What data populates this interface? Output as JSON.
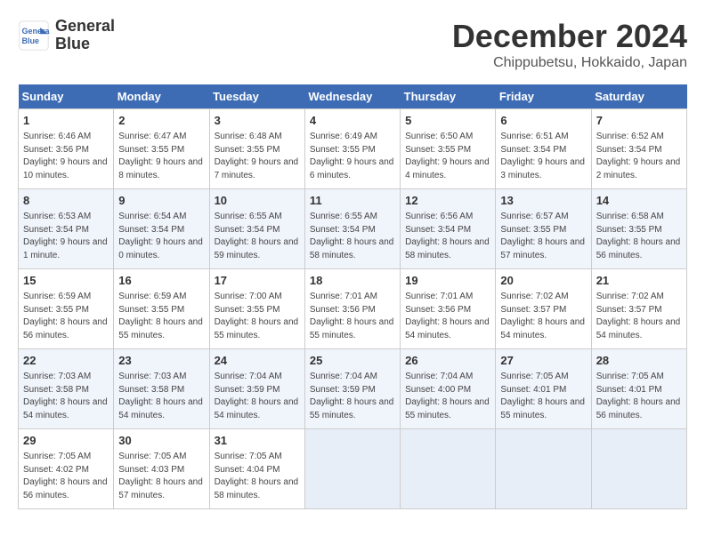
{
  "logo": {
    "line1": "General",
    "line2": "Blue"
  },
  "title": "December 2024",
  "subtitle": "Chippubetsu, Hokkaido, Japan",
  "headers": [
    "Sunday",
    "Monday",
    "Tuesday",
    "Wednesday",
    "Thursday",
    "Friday",
    "Saturday"
  ],
  "weeks": [
    [
      {
        "day": "1",
        "info": "Sunrise: 6:46 AM\nSunset: 3:56 PM\nDaylight: 9 hours and 10 minutes."
      },
      {
        "day": "2",
        "info": "Sunrise: 6:47 AM\nSunset: 3:55 PM\nDaylight: 9 hours and 8 minutes."
      },
      {
        "day": "3",
        "info": "Sunrise: 6:48 AM\nSunset: 3:55 PM\nDaylight: 9 hours and 7 minutes."
      },
      {
        "day": "4",
        "info": "Sunrise: 6:49 AM\nSunset: 3:55 PM\nDaylight: 9 hours and 6 minutes."
      },
      {
        "day": "5",
        "info": "Sunrise: 6:50 AM\nSunset: 3:55 PM\nDaylight: 9 hours and 4 minutes."
      },
      {
        "day": "6",
        "info": "Sunrise: 6:51 AM\nSunset: 3:54 PM\nDaylight: 9 hours and 3 minutes."
      },
      {
        "day": "7",
        "info": "Sunrise: 6:52 AM\nSunset: 3:54 PM\nDaylight: 9 hours and 2 minutes."
      }
    ],
    [
      {
        "day": "8",
        "info": "Sunrise: 6:53 AM\nSunset: 3:54 PM\nDaylight: 9 hours and 1 minute."
      },
      {
        "day": "9",
        "info": "Sunrise: 6:54 AM\nSunset: 3:54 PM\nDaylight: 9 hours and 0 minutes."
      },
      {
        "day": "10",
        "info": "Sunrise: 6:55 AM\nSunset: 3:54 PM\nDaylight: 8 hours and 59 minutes."
      },
      {
        "day": "11",
        "info": "Sunrise: 6:55 AM\nSunset: 3:54 PM\nDaylight: 8 hours and 58 minutes."
      },
      {
        "day": "12",
        "info": "Sunrise: 6:56 AM\nSunset: 3:54 PM\nDaylight: 8 hours and 58 minutes."
      },
      {
        "day": "13",
        "info": "Sunrise: 6:57 AM\nSunset: 3:55 PM\nDaylight: 8 hours and 57 minutes."
      },
      {
        "day": "14",
        "info": "Sunrise: 6:58 AM\nSunset: 3:55 PM\nDaylight: 8 hours and 56 minutes."
      }
    ],
    [
      {
        "day": "15",
        "info": "Sunrise: 6:59 AM\nSunset: 3:55 PM\nDaylight: 8 hours and 56 minutes."
      },
      {
        "day": "16",
        "info": "Sunrise: 6:59 AM\nSunset: 3:55 PM\nDaylight: 8 hours and 55 minutes."
      },
      {
        "day": "17",
        "info": "Sunrise: 7:00 AM\nSunset: 3:55 PM\nDaylight: 8 hours and 55 minutes."
      },
      {
        "day": "18",
        "info": "Sunrise: 7:01 AM\nSunset: 3:56 PM\nDaylight: 8 hours and 55 minutes."
      },
      {
        "day": "19",
        "info": "Sunrise: 7:01 AM\nSunset: 3:56 PM\nDaylight: 8 hours and 54 minutes."
      },
      {
        "day": "20",
        "info": "Sunrise: 7:02 AM\nSunset: 3:57 PM\nDaylight: 8 hours and 54 minutes."
      },
      {
        "day": "21",
        "info": "Sunrise: 7:02 AM\nSunset: 3:57 PM\nDaylight: 8 hours and 54 minutes."
      }
    ],
    [
      {
        "day": "22",
        "info": "Sunrise: 7:03 AM\nSunset: 3:58 PM\nDaylight: 8 hours and 54 minutes."
      },
      {
        "day": "23",
        "info": "Sunrise: 7:03 AM\nSunset: 3:58 PM\nDaylight: 8 hours and 54 minutes."
      },
      {
        "day": "24",
        "info": "Sunrise: 7:04 AM\nSunset: 3:59 PM\nDaylight: 8 hours and 54 minutes."
      },
      {
        "day": "25",
        "info": "Sunrise: 7:04 AM\nSunset: 3:59 PM\nDaylight: 8 hours and 55 minutes."
      },
      {
        "day": "26",
        "info": "Sunrise: 7:04 AM\nSunset: 4:00 PM\nDaylight: 8 hours and 55 minutes."
      },
      {
        "day": "27",
        "info": "Sunrise: 7:05 AM\nSunset: 4:01 PM\nDaylight: 8 hours and 55 minutes."
      },
      {
        "day": "28",
        "info": "Sunrise: 7:05 AM\nSunset: 4:01 PM\nDaylight: 8 hours and 56 minutes."
      }
    ],
    [
      {
        "day": "29",
        "info": "Sunrise: 7:05 AM\nSunset: 4:02 PM\nDaylight: 8 hours and 56 minutes."
      },
      {
        "day": "30",
        "info": "Sunrise: 7:05 AM\nSunset: 4:03 PM\nDaylight: 8 hours and 57 minutes."
      },
      {
        "day": "31",
        "info": "Sunrise: 7:05 AM\nSunset: 4:04 PM\nDaylight: 8 hours and 58 minutes."
      },
      null,
      null,
      null,
      null
    ]
  ]
}
